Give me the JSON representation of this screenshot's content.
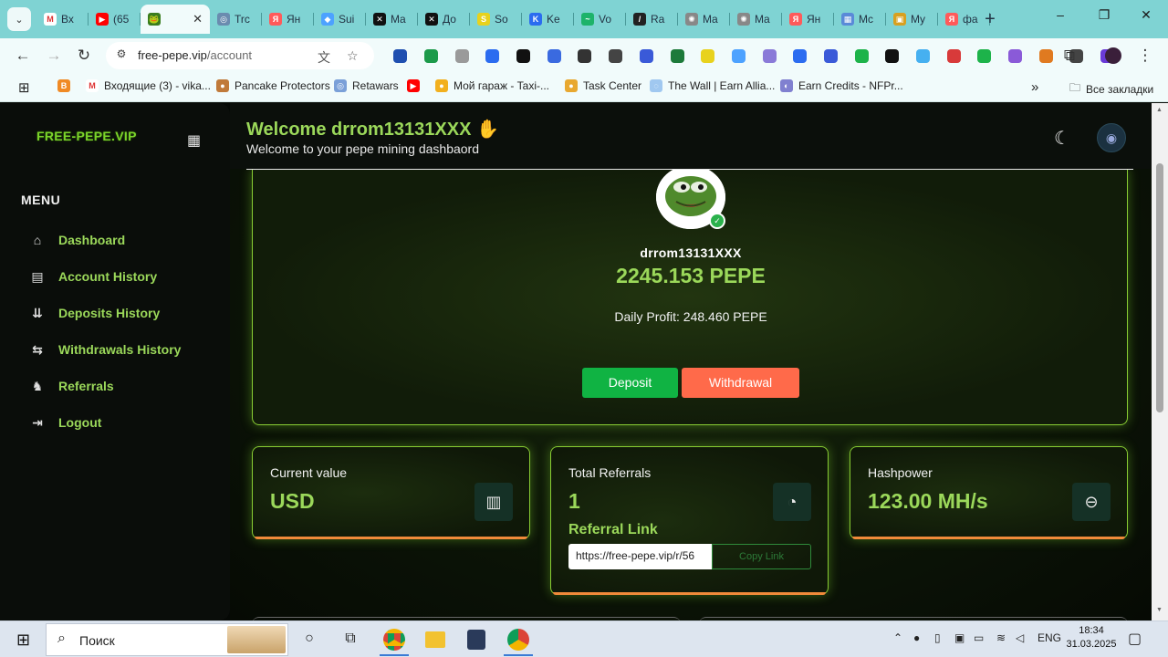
{
  "browser": {
    "tabs": [
      {
        "label": "Вх",
        "color": "#ffffff",
        "glyph": "M"
      },
      {
        "label": "(65",
        "color": "#ff0000",
        "glyph": "▶"
      },
      {
        "label": "",
        "color": "#3a7d1e",
        "glyph": "🐸",
        "active": true
      },
      {
        "label": "Trc",
        "color": "#6a8caf",
        "glyph": "◎"
      },
      {
        "label": "Ян",
        "color": "#ff5a5a",
        "glyph": "Я"
      },
      {
        "label": "Sui",
        "color": "#4da2ff",
        "glyph": "◆"
      },
      {
        "label": "Ma",
        "color": "#111111",
        "glyph": "✕"
      },
      {
        "label": "До",
        "color": "#111111",
        "glyph": "✕"
      },
      {
        "label": "So",
        "color": "#e8d21d",
        "glyph": "S"
      },
      {
        "label": "Ke",
        "color": "#2b6cf0",
        "glyph": "K"
      },
      {
        "label": "Vo",
        "color": "#1db36a",
        "glyph": "~"
      },
      {
        "label": "Ra",
        "color": "#222222",
        "glyph": "/"
      },
      {
        "label": "Ma",
        "color": "#888888",
        "glyph": "✺"
      },
      {
        "label": "Ma",
        "color": "#888888",
        "glyph": "✺"
      },
      {
        "label": "Ян",
        "color": "#ff5a5a",
        "glyph": "Я"
      },
      {
        "label": "Mc",
        "color": "#5a8ad8",
        "glyph": "▦"
      },
      {
        "label": "My",
        "color": "#d8a020",
        "glyph": "▣"
      },
      {
        "label": "фа",
        "color": "#ff5a5a",
        "glyph": "Я"
      }
    ],
    "url_domain": "free-pepe.vip",
    "url_path": "/account",
    "bookmarks": [
      {
        "label": "",
        "color": "#f08a24",
        "glyph": "B"
      },
      {
        "label": "Входящие (3) - vika...",
        "color": "#ffffff",
        "glyph": "M"
      },
      {
        "label": "Pancake Protectors",
        "color": "#c07a3a",
        "glyph": "●"
      },
      {
        "label": "Retawars",
        "color": "#7aa0d8",
        "glyph": "◎"
      },
      {
        "label": "",
        "color": "#ff0000",
        "glyph": "▶"
      },
      {
        "label": "Мой гараж - Taxi-...",
        "color": "#f2b01e",
        "glyph": "●"
      },
      {
        "label": "Task Center",
        "color": "#e8a830",
        "glyph": "●"
      },
      {
        "label": "The Wall | Earn Allia...",
        "color": "#a0c8f0",
        "glyph": "◌"
      },
      {
        "label": "Earn Credits - NFPr...",
        "color": "#8080d0",
        "glyph": "◐"
      }
    ],
    "bookmarks_more": "»",
    "all_bookmarks": "Все закладки",
    "extension_colors": [
      "#1f4fb0",
      "#1c9a4a",
      "#9a9a9a",
      "#2b6cf0",
      "#111111",
      "#3a6ae0",
      "#333333",
      "#444444",
      "#3a5ad8",
      "#1d7a3a",
      "#e8d21d",
      "#4da2ff",
      "#8a7ad8",
      "#2b6cf0",
      "#3a5ad8",
      "#1db34a",
      "#111111",
      "#46b0f0",
      "#d83a3a",
      "#1db34a",
      "#8a5ad8",
      "#e07a20",
      "#444444",
      "#6a3ad8"
    ]
  },
  "sidebar": {
    "logo": "FREE-PEPE.VIP",
    "menu_heading": "MENU",
    "items": [
      {
        "label": "Dashboard",
        "icon": "⌂"
      },
      {
        "label": "Account History",
        "icon": "▤"
      },
      {
        "label": "Deposits History",
        "icon": "⇊"
      },
      {
        "label": "Withdrawals History",
        "icon": "⇆"
      },
      {
        "label": "Referrals",
        "icon": "♞"
      },
      {
        "label": "Logout",
        "icon": "⇥"
      }
    ]
  },
  "header": {
    "welcome": "Welcome drrom13131XXX ✋",
    "subtitle": "Welcome to your pepe mining dashbaord"
  },
  "profile": {
    "username": "drrom13131XXX",
    "balance": "2245.153 PEPE",
    "daily_profit": "Daily Profit: 248.460 PEPE",
    "deposit_label": "Deposit",
    "withdrawal_label": "Withdrawal"
  },
  "cards": {
    "current_value": {
      "title": "Current value",
      "value": "USD"
    },
    "total_referrals": {
      "title": "Total Referrals",
      "value": "1",
      "link_label": "Referral Link",
      "link_value": "https://free-pepe.vip/r/56",
      "copy_label": "Copy Link"
    },
    "hashpower": {
      "title": "Hashpower",
      "value": "123.00 MH/s"
    }
  },
  "taskbar": {
    "search_placeholder": "Поиск",
    "language": "ENG",
    "time": "18:34",
    "date": "31.03.2025"
  }
}
